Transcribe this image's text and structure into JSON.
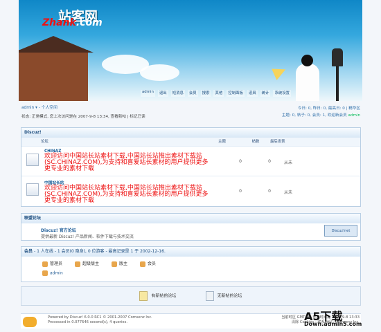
{
  "logo": {
    "cn": "站客网",
    "en_prefix": "Zhank",
    "en_suffix": ".com"
  },
  "nav": [
    "admin",
    "退出",
    "短消息",
    "会员",
    "搜索",
    "其他",
    "控制面板",
    "道具",
    "统计",
    "系统设置"
  ],
  "user": {
    "line": "admin ▾ - 个人空间",
    "status": "状态: 正常模式, 您上次访问是在 2007-9-8 13:34, 查看新帖 | 标记已读"
  },
  "right": {
    "line1": "今日: 0, 昨日: 0, 最高日: 0 | 精华区",
    "line2": "主题: 0, 帖子: 0, 会员: 1, 欢迎新会员",
    "new_user": "admin"
  },
  "forum": {
    "section": "Discuz!",
    "headers": [
      "论坛",
      "主题",
      "帖数",
      "最后发表"
    ],
    "rows": [
      {
        "name": "CHINAZ",
        "desc": "欢迎访问中国站长站素材下载,中国站长站推出素材下载站(SC.CHINAZ.COM),为支持和喜爱站长素材的用户提供更多更专业的素材下载",
        "topics": "0",
        "posts": "0",
        "last": "从未"
      },
      {
        "name": "中国站长站",
        "desc": "欢迎访问中国站长站素材下载,中国站长站推出素材下载站(SC.CHINAZ.COM),为支持和喜爱站长素材的用户提供更多更专业的素材下载",
        "topics": "0",
        "posts": "0",
        "last": "从未"
      }
    ]
  },
  "alliance": {
    "title": "联盟论坛",
    "name": "Discuz! 官方论坛",
    "desc": "提供最新 Discuz! 产品新闻、软件下载与技术交流",
    "logo": "Discuz!net"
  },
  "online": {
    "title": "会员",
    "summary": "- 1 人在线 - 1 会员(0 隐身), 0 位游客 - 最高记录是 1 于 2002-12-16.",
    "legend": [
      "管理员",
      "超级版主",
      "版主",
      "会员"
    ],
    "user": "admin"
  },
  "legend": [
    "有新帖的论坛",
    "无新帖的论坛"
  ],
  "footer": {
    "powered": "Powered by Discuz! 6.0.0 RC1 © 2001-2007 Comsenz Inc.",
    "processed": "Processed in 0.077646 second(s), 4 queries.",
    "time": "当前时区 GMT+8, 现在时间是 2007-9-8 13:33",
    "links": "清除 Cookies - 联系我们 - Comsenz Inc."
  },
  "watermark": {
    "big": "A5下载",
    "small": "Down.admin5.com"
  }
}
